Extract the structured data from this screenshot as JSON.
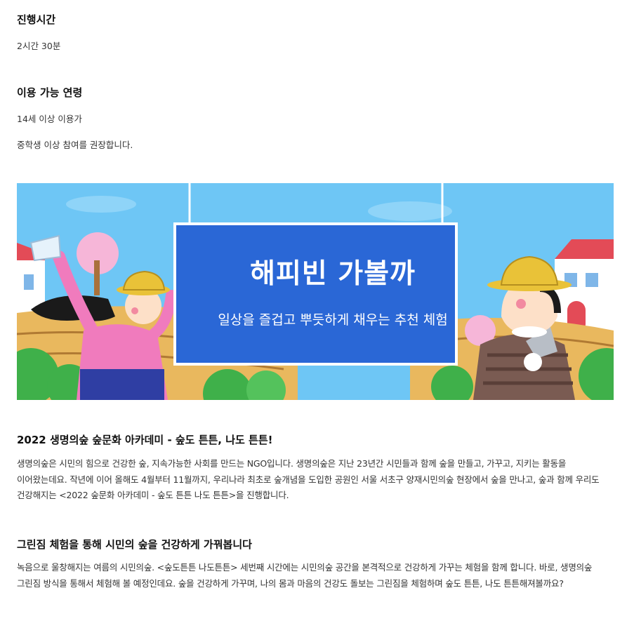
{
  "duration": {
    "heading": "진행시간",
    "value": "2시간 30분"
  },
  "age": {
    "heading": "이용 가능 연령",
    "value": "14세 이상 이용가",
    "note": "중학생 이상 참여를 권장합니다."
  },
  "banner": {
    "title": "해피빈 가볼까",
    "subtitle": "일상을 즐겁고 뿌듯하게 채우는 추천 체험",
    "colors": {
      "sky": "#6ec6f5",
      "sign": "#2a67d6",
      "shirt_pink": "#f07bbd",
      "bush_green": "#3fb04a"
    }
  },
  "section1": {
    "heading": "2022 생명의숲 숲문화 아카데미 - 숲도 튼튼, 나도 튼튼!",
    "body": "생명의숲은 시민의 힘으로 건강한 숲, 지속가능한 사회를 만드는 NGO입니다. 생명의숲은 지난 23년간 시민들과 함께 숲을 만들고, 가꾸고, 지키는 활동을 이어왔는데요. 작년에 이어 올해도 4월부터 11월까지, 우리나라 최초로 숲개념을 도입한 공원인 서울 서초구 양재시민의숲 현장에서 숲을 만나고, 숲과 함께 우리도 건강해지는 <2022 숲문화 아카데미 - 숲도 튼튼 나도 튼튼>을 진행합니다."
  },
  "section2": {
    "heading": "그린짐 체험을 통해 시민의 숲을 건강하게 가꿔봅니다",
    "body": "녹음으로 울창해지는 여름의 시민의숲. <숲도튼튼 나도튼튼> 세번째 시간에는 시민의숲 공간을 본격적으로 건강하게 가꾸는 체험을 함께 합니다. 바로, 생명의숲 그린짐 방식을 통해서 체험해 볼 예정인데요. 숲을 건강하게 가꾸며, 나의 몸과 마음의 건강도 돌보는 그린짐을 체험하며 숲도 튼튼, 나도 튼튼해져볼까요?"
  }
}
